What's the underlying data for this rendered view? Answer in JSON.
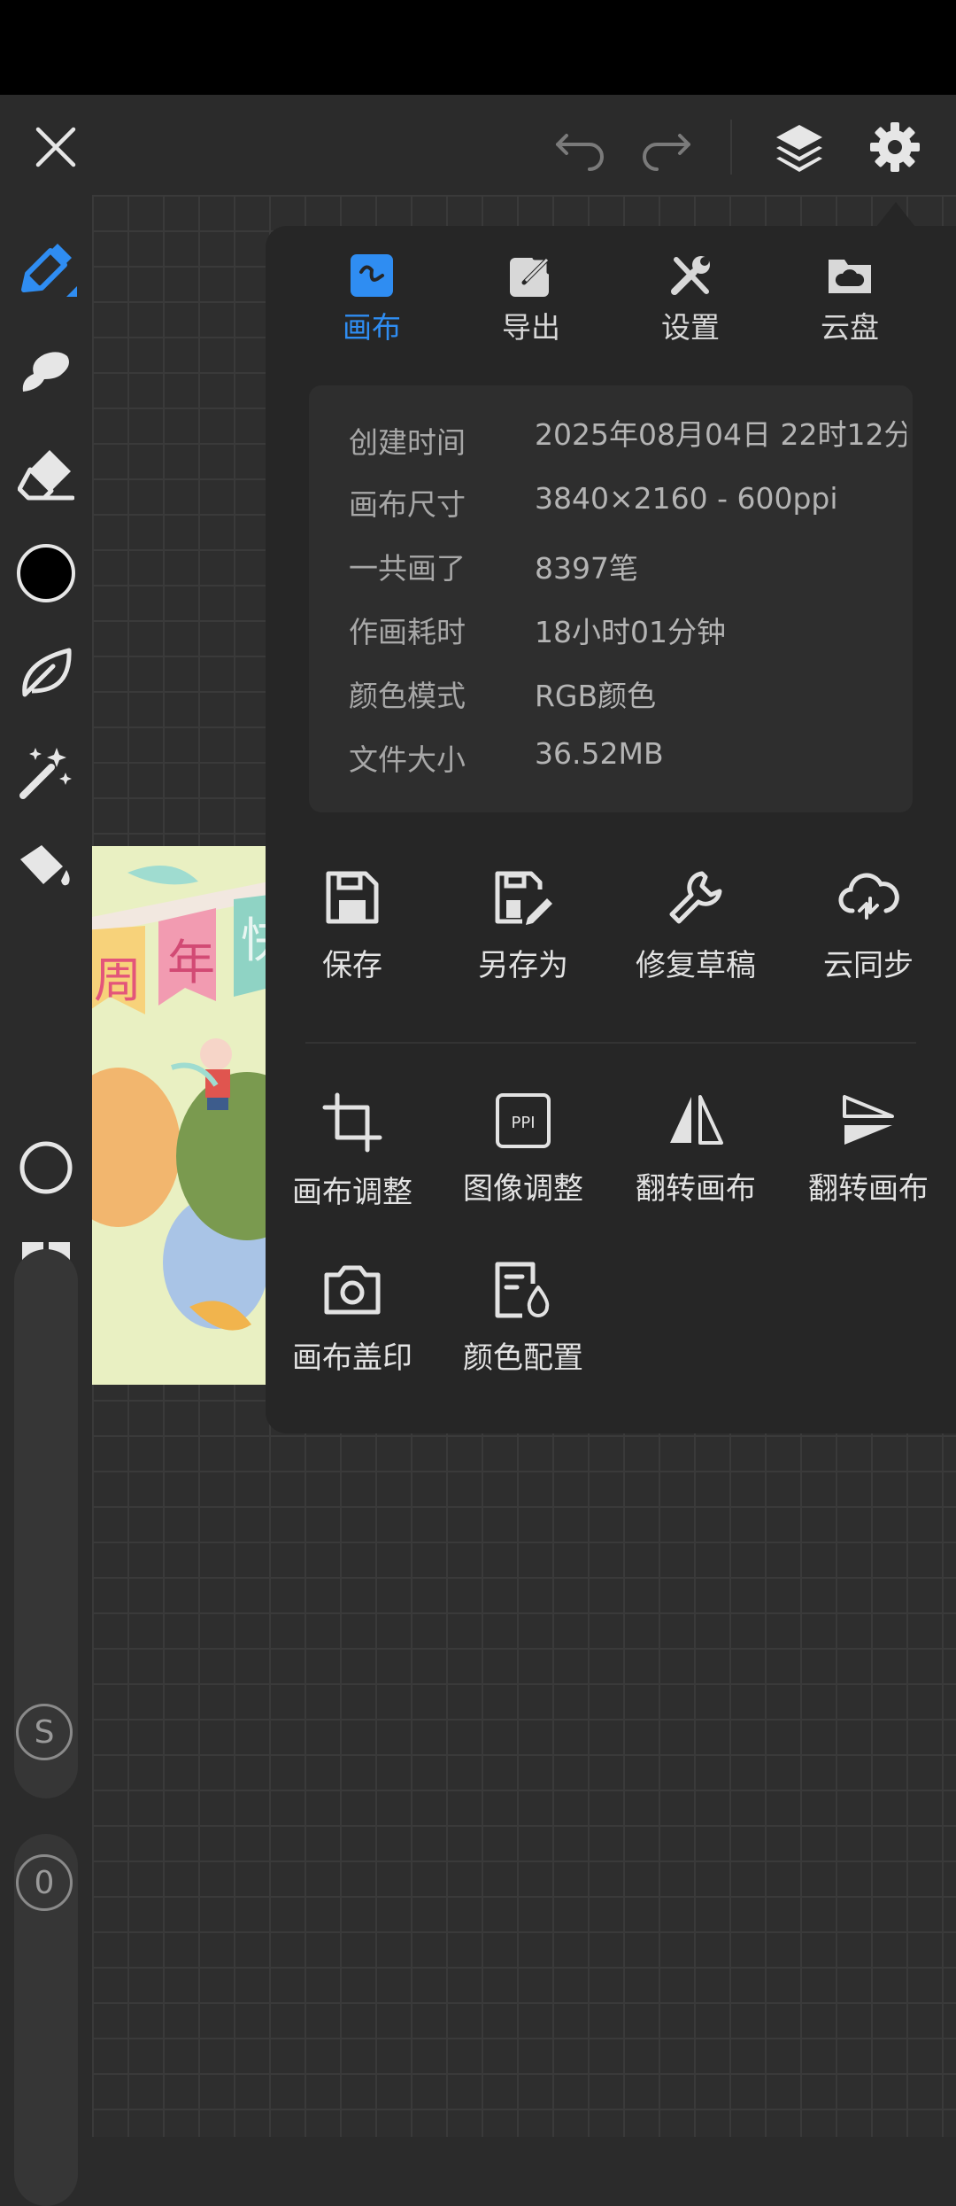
{
  "toolbar": {
    "close_icon": "close-icon",
    "undo_icon": "undo-icon",
    "redo_icon": "redo-icon",
    "layers_icon": "layers-icon",
    "settings_icon": "gear-icon"
  },
  "left_tools": [
    {
      "name": "brush",
      "icon": "pen-icon",
      "active": true
    },
    {
      "name": "smudge",
      "icon": "smudge-icon"
    },
    {
      "name": "eraser",
      "icon": "eraser-icon"
    },
    {
      "name": "color",
      "icon": "color-swatch",
      "value": "#000000"
    },
    {
      "name": "lasso",
      "icon": "leaf-icon"
    },
    {
      "name": "magic",
      "icon": "magic-wand-icon"
    },
    {
      "name": "fill",
      "icon": "paint-bucket-icon"
    },
    {
      "name": "shape",
      "icon": "circle-icon"
    },
    {
      "name": "more",
      "icon": "grid-icon"
    }
  ],
  "sliders": {
    "size_label": "S",
    "opacity_label": "0"
  },
  "panel": {
    "tabs": [
      {
        "label": "画布",
        "icon": "canvas-icon",
        "active": true
      },
      {
        "label": "导出",
        "icon": "export-icon"
      },
      {
        "label": "设置",
        "icon": "tools-icon"
      },
      {
        "label": "云盘",
        "icon": "cloud-folder-icon"
      }
    ],
    "info": [
      {
        "key": "创建时间",
        "value": "2025年08月04日 22时12分"
      },
      {
        "key": "画布尺寸",
        "value": "3840×2160 - 600ppi"
      },
      {
        "key": "一共画了",
        "value": "8397笔"
      },
      {
        "key": "作画耗时",
        "value": "18小时01分钟"
      },
      {
        "key": "颜色模式",
        "value": "RGB颜色"
      },
      {
        "key": "文件大小",
        "value": "36.52MB"
      }
    ],
    "actions_row1": [
      {
        "label": "保存",
        "icon": "save-icon"
      },
      {
        "label": "另存为",
        "icon": "save-as-icon"
      },
      {
        "label": "修复草稿",
        "icon": "wrench-icon"
      },
      {
        "label": "云同步",
        "icon": "cloud-sync-icon"
      }
    ],
    "actions_row2": [
      {
        "label": "画布调整",
        "icon": "crop-icon"
      },
      {
        "label": "图像调整",
        "icon": "ppi-icon",
        "icon_text": "PPI"
      },
      {
        "label": "翻转画布",
        "icon": "flip-horizontal-icon"
      },
      {
        "label": "翻转画布",
        "icon": "flip-vertical-icon"
      }
    ],
    "actions_row3": [
      {
        "label": "画布盖印",
        "icon": "camera-icon"
      },
      {
        "label": "颜色配置",
        "icon": "color-config-icon"
      }
    ]
  },
  "artwork": {
    "banner_chars": [
      "周",
      "年",
      "快"
    ]
  },
  "colors": {
    "accent": "#2f8df2",
    "panel_bg": "#262626",
    "toolbar_bg": "#2b2b2b"
  }
}
